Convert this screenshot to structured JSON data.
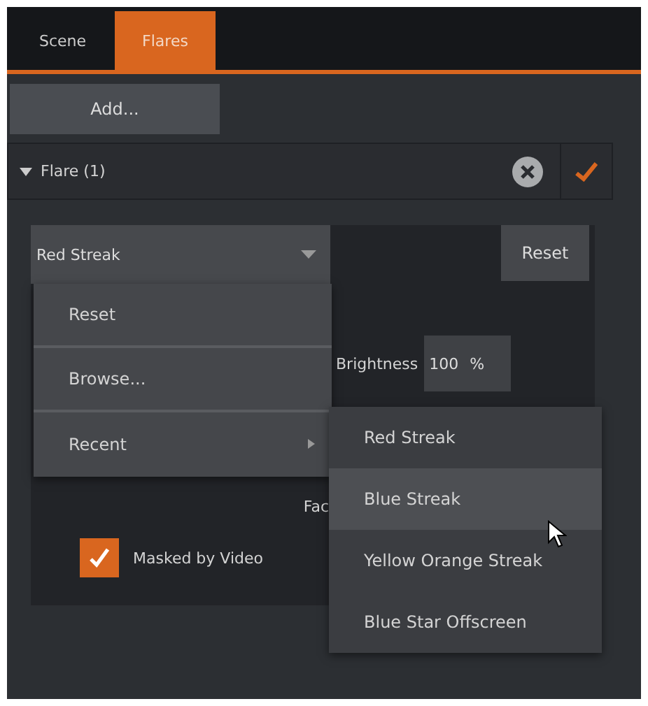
{
  "tabs": [
    {
      "label": "Scene",
      "selected": false
    },
    {
      "label": "Flares",
      "selected": true
    }
  ],
  "add_button": "Add...",
  "flare": {
    "title": "Flare (1)",
    "expanded": true,
    "enabled": true,
    "preset": {
      "value": "Red Streak"
    },
    "reset_button": "Reset",
    "preset_menu": [
      {
        "label": "Reset",
        "kind": "action"
      },
      {
        "label": "Browse...",
        "kind": "action"
      },
      {
        "label": "Recent",
        "kind": "submenu"
      }
    ],
    "recent_menu": [
      {
        "label": "Red Streak",
        "selected": false
      },
      {
        "label": "Blue Streak",
        "selected": true
      },
      {
        "label": "Yellow Orange Streak",
        "selected": false
      },
      {
        "label": "Blue Star Offscreen",
        "selected": false
      }
    ],
    "brightness": {
      "label": "Brightness",
      "value": "100",
      "unit": "%"
    },
    "partial_label": "Fac",
    "masked_by_video": {
      "label": "Masked by Video",
      "checked": true
    }
  }
}
